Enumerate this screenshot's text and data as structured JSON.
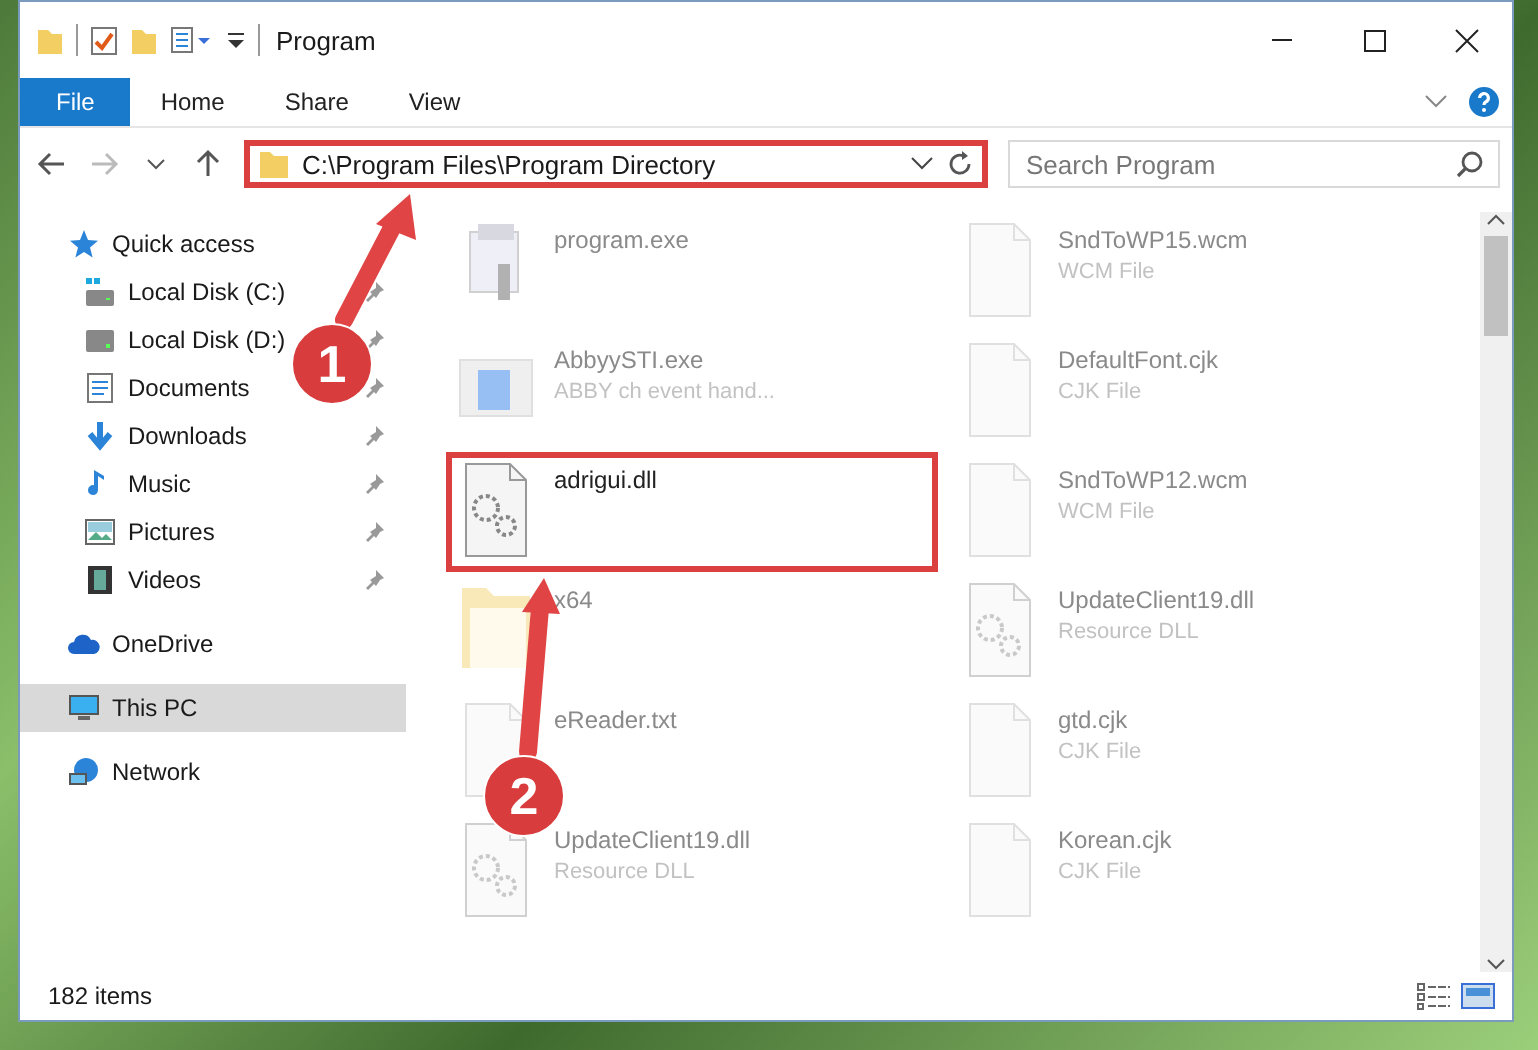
{
  "window": {
    "title": "Program"
  },
  "ribbon_tabs": [
    {
      "label": "File",
      "selected": true
    },
    {
      "label": "Home",
      "selected": false
    },
    {
      "label": "Share",
      "selected": false
    },
    {
      "label": "View",
      "selected": false
    }
  ],
  "address_bar": {
    "path": "C:\\Program Files\\Program Directory",
    "highlighted": true
  },
  "search": {
    "placeholder": "Search Program"
  },
  "sidebar": {
    "items": [
      {
        "label": "Quick access",
        "kind": "star",
        "selected": false,
        "children": [
          {
            "label": "Local Disk (C:)",
            "kind": "system-drive",
            "pinned": true,
            "selected": false
          },
          {
            "label": "Local Disk (D:)",
            "kind": "drive",
            "pinned": true,
            "selected": false
          },
          {
            "label": "Documents",
            "kind": "documents",
            "pinned": true,
            "selected": false
          },
          {
            "label": "Downloads",
            "kind": "downloads",
            "pinned": true,
            "selected": false
          },
          {
            "label": "Music",
            "kind": "music",
            "pinned": true,
            "selected": false
          },
          {
            "label": "Pictures",
            "kind": "pictures",
            "pinned": true,
            "selected": false
          },
          {
            "label": "Videos",
            "kind": "videos",
            "pinned": true,
            "selected": false
          }
        ]
      },
      {
        "label": "OneDrive",
        "kind": "cloud",
        "selected": false
      },
      {
        "label": "This PC",
        "kind": "pc",
        "selected": true
      },
      {
        "label": "Network",
        "kind": "network",
        "selected": false
      }
    ]
  },
  "files": [
    {
      "name": "program.exe",
      "kind": "exe",
      "blurred": true,
      "highlighted": false
    },
    {
      "name": "SndToWP15.wcm",
      "type": "WCM File",
      "kind": "file",
      "blurred": true,
      "highlighted": false
    },
    {
      "name": "AbbyySTI.exe",
      "type": "ABBY ch event hand...",
      "kind": "app",
      "blurred": true,
      "highlighted": false
    },
    {
      "name": "DefaultFont.cjk",
      "type": "CJK File",
      "kind": "file",
      "blurred": true,
      "highlighted": false
    },
    {
      "name": "adrigui.dll",
      "kind": "dll",
      "blurred": false,
      "highlighted": true
    },
    {
      "name": "SndToWP12.wcm",
      "type": "WCM File",
      "kind": "file",
      "blurred": true,
      "highlighted": false
    },
    {
      "name": "x64",
      "kind": "folder",
      "blurred": true,
      "highlighted": false
    },
    {
      "name": "UpdateClient19.dll",
      "type": "Resource DLL",
      "kind": "dll",
      "blurred": true,
      "highlighted": false
    },
    {
      "name": "eReader.txt",
      "kind": "file",
      "blurred": true,
      "highlighted": false
    },
    {
      "name": "gtd.cjk",
      "type": "CJK File",
      "kind": "file",
      "blurred": true,
      "highlighted": false
    },
    {
      "name": "UpdateClient19.dll",
      "type": "Resource DLL",
      "kind": "dll",
      "blurred": true,
      "highlighted": false
    },
    {
      "name": "Korean.cjk",
      "type": "CJK File",
      "kind": "file",
      "blurred": true,
      "highlighted": false
    }
  ],
  "annotations": [
    {
      "number": "1"
    },
    {
      "number": "2"
    }
  ],
  "status_bar": {
    "item_count": "182 items"
  }
}
